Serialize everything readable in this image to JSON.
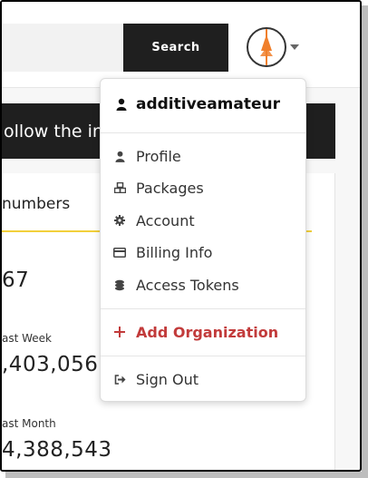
{
  "search": {
    "placeholder": "",
    "button_label": "Search"
  },
  "banner": {
    "text": "ollow the in"
  },
  "card": {
    "heading": "numbers",
    "stats": [
      {
        "label": "",
        "value": "67"
      },
      {
        "label": "ast Week",
        "value": ",403,056"
      },
      {
        "label": "ast Month",
        "value": "4,388,543"
      }
    ]
  },
  "menu": {
    "username": "additiveamateur",
    "items": [
      {
        "label": "Profile",
        "icon": "user-icon"
      },
      {
        "label": "Packages",
        "icon": "cubes-icon"
      },
      {
        "label": "Account",
        "icon": "gear-icon"
      },
      {
        "label": "Billing Info",
        "icon": "credit-card-icon"
      },
      {
        "label": "Access Tokens",
        "icon": "coins-icon"
      }
    ],
    "add_org": "Add Organization",
    "sign_out": "Sign Out"
  },
  "colors": {
    "accent_red": "#c23b3b",
    "dark": "#1f1f1f",
    "underline_yellow": "#f2d03b",
    "avatar_orange": "#f07f2c"
  }
}
